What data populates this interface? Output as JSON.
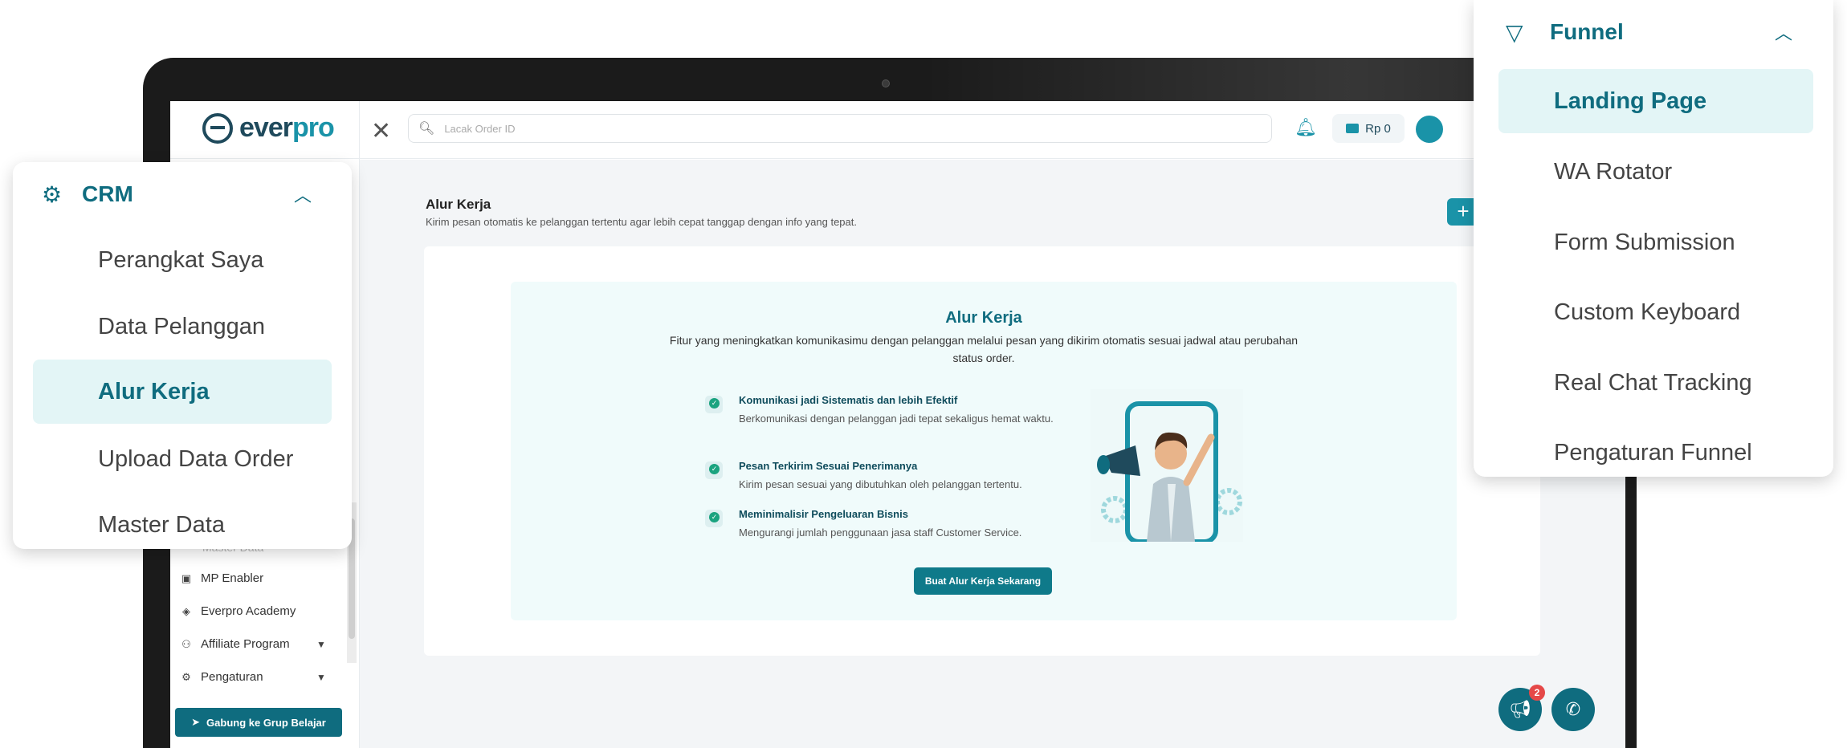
{
  "app": {
    "logo_prefix": "ever",
    "logo_suffix": "pro",
    "search_placeholder": "Lacak Order ID",
    "balance": "Rp 0"
  },
  "sidebar": {
    "ghost_item": "Master Data",
    "items": [
      {
        "label": "MP Enabler",
        "icon": "store-icon"
      },
      {
        "label": "Everpro Academy",
        "icon": "academy-icon"
      },
      {
        "label": "Affiliate Program",
        "icon": "affiliate-icon",
        "expandable": true
      },
      {
        "label": "Pengaturan",
        "icon": "gear-icon",
        "expandable": true
      }
    ],
    "join_button": "Gabung ke Grup Belajar"
  },
  "page": {
    "title": "Alur Kerja",
    "subtitle": "Kirim pesan otomatis ke pelanggan tertentu agar lebih cepat tanggap dengan info yang tepat.",
    "add_label": "+"
  },
  "hero": {
    "title": "Alur Kerja",
    "description": "Fitur yang meningkatkan komunikasimu dengan pelanggan melalui pesan yang dikirim otomatis sesuai jadwal atau perubahan status order.",
    "features": [
      {
        "title": "Komunikasi jadi Sistematis dan lebih Efektif",
        "desc": "Berkomunikasi dengan pelanggan jadi tepat sekaligus hemat waktu."
      },
      {
        "title": "Pesan Terkirim Sesuai Penerimanya",
        "desc": "Kirim pesan sesuai yang dibutuhkan oleh pelanggan tertentu."
      },
      {
        "title": "Meminimalisir Pengeluaran Bisnis",
        "desc": "Mengurangi jumlah penggunaan jasa staff Customer Service."
      }
    ],
    "cta": "Buat Alur Kerja Sekarang"
  },
  "floating": {
    "notification_count": "2"
  },
  "crm_menu": {
    "title": "CRM",
    "items": [
      {
        "label": "Perangkat Saya",
        "active": false
      },
      {
        "label": "Data Pelanggan",
        "active": false
      },
      {
        "label": "Alur Kerja",
        "active": true
      },
      {
        "label": "Upload Data Order",
        "active": false
      },
      {
        "label": "Master Data",
        "active": false
      }
    ]
  },
  "funnel_menu": {
    "title": "Funnel",
    "items": [
      {
        "label": "Landing Page",
        "active": true
      },
      {
        "label": "WA Rotator",
        "active": false
      },
      {
        "label": "Form Submission",
        "active": false
      },
      {
        "label": "Custom Keyboard",
        "active": false
      },
      {
        "label": "Real Chat Tracking",
        "active": false
      },
      {
        "label": "Pengaturan Funnel",
        "active": false
      }
    ]
  },
  "colors": {
    "brand": "#0f6c7f",
    "accent": "#1a93a8",
    "active_bg": "#e3f5f6",
    "badge": "#e54848"
  }
}
